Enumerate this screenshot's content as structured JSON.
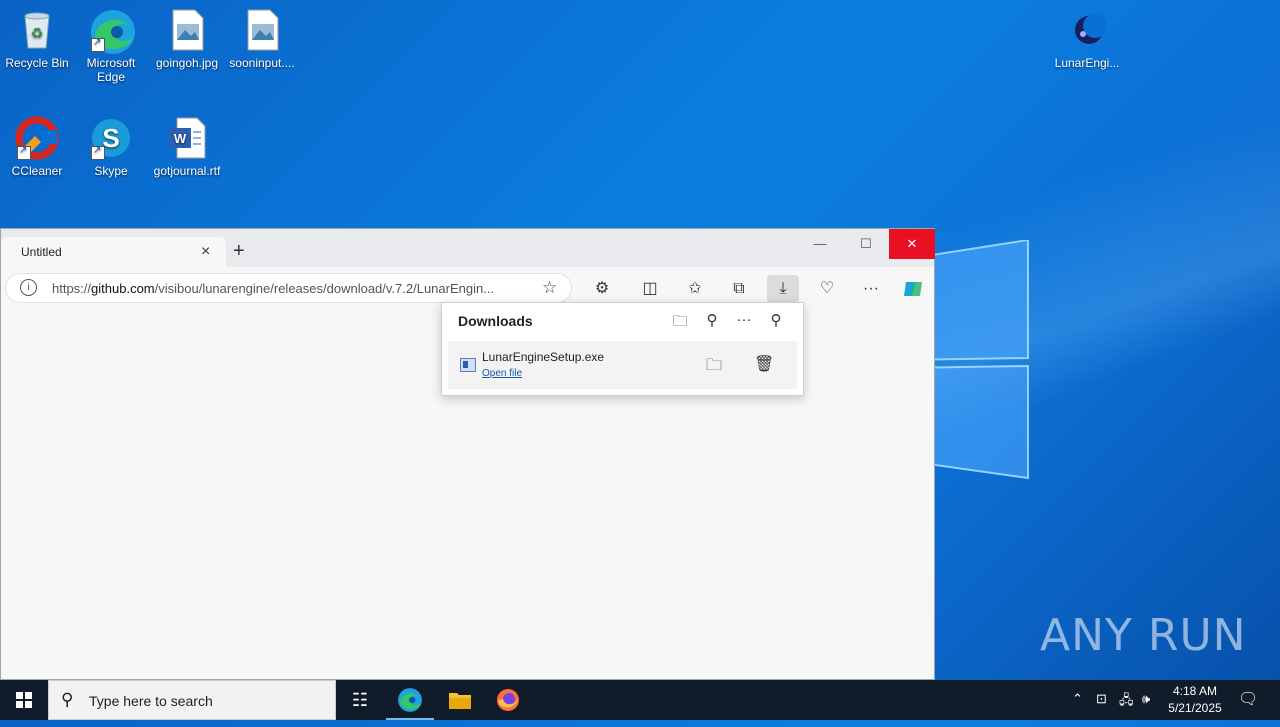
{
  "desktop": {
    "icons": [
      {
        "label": "Recycle Bin"
      },
      {
        "label": "Microsoft Edge"
      },
      {
        "label": "goingoh.jpg"
      },
      {
        "label": "sooninput...."
      },
      {
        "label": "LunarEngi..."
      },
      {
        "label": "CCleaner"
      },
      {
        "label": "Skype"
      },
      {
        "label": "gotjournal.rtf"
      }
    ],
    "watermark": "ANY RUN"
  },
  "browser": {
    "tab_title": "Untitled",
    "url_prefix": "https://",
    "url_domain": "github.com",
    "url_rest": "/visibou/lunarengine/releases/download/v.7.2/LunarEngin...",
    "downloads": {
      "title": "Downloads",
      "items": [
        {
          "filename": "LunarEngineSetup.exe",
          "action": "Open file"
        }
      ]
    }
  },
  "taskbar": {
    "search_placeholder": "Type here to search",
    "time": "4:18 AM",
    "date": "5/21/2025"
  },
  "colors": {
    "accent": "#0078d4",
    "close": "#e81123",
    "taskbar": "#101c2a"
  }
}
